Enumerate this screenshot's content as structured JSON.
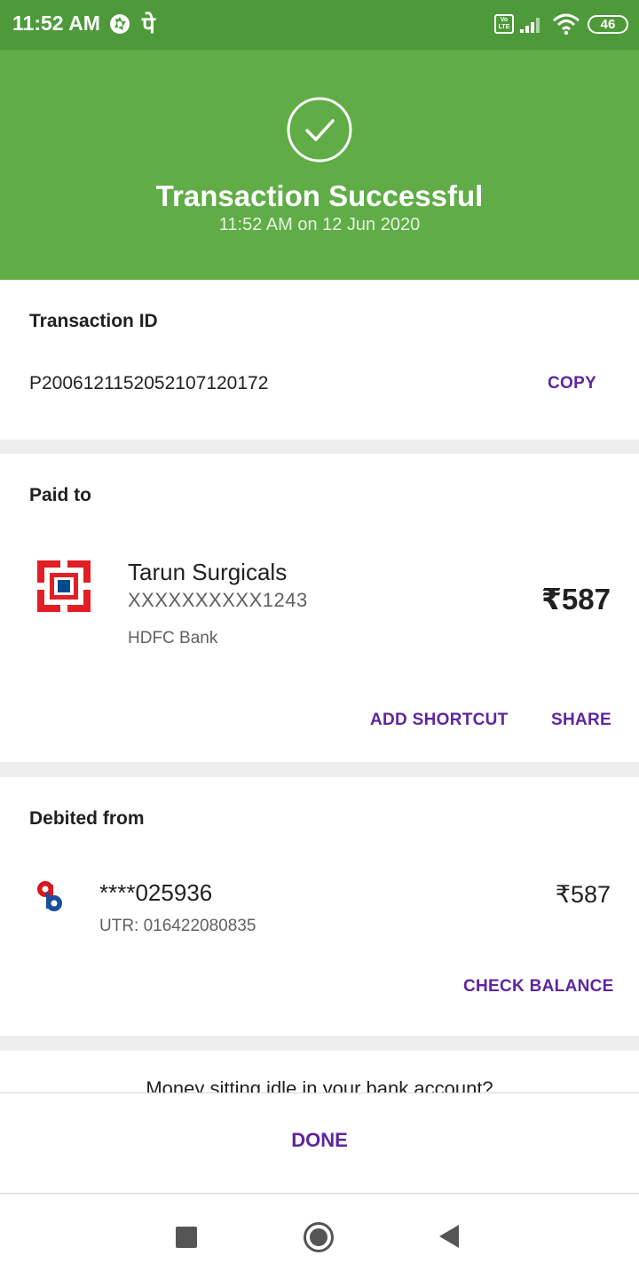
{
  "status_bar": {
    "time": "11:52 AM",
    "app_glyph": "पे",
    "network_badge": "Vo LTE",
    "battery": "46",
    "icons": [
      "aperture-icon",
      "volte-icon",
      "signal-icon",
      "wifi-icon",
      "battery-icon"
    ]
  },
  "header": {
    "title": "Transaction Successful",
    "subtitle": "11:52 AM on 12 Jun 2020",
    "icon": "check-circle-icon",
    "color": "#60ac47"
  },
  "transaction": {
    "label": "Transaction ID",
    "id": "P2006121152052107120172",
    "copy_label": "COPY"
  },
  "paid_to": {
    "label": "Paid to",
    "name": "Tarun Surgicals",
    "account": "XXXXXXXXXX1243",
    "bank": "HDFC Bank",
    "amount": "₹587",
    "logo": "hdfc-bank-logo",
    "actions": {
      "add_shortcut": "ADD SHORTCUT",
      "share": "SHARE"
    }
  },
  "debited_from": {
    "label": "Debited from",
    "account": "****025936",
    "utr": "UTR: 016422080835",
    "amount": "₹587",
    "logo": "union-bank-logo",
    "action": "CHECK BALANCE"
  },
  "promo": {
    "text": "Money sitting idle in your bank account?"
  },
  "footer": {
    "done_label": "DONE"
  },
  "nav": {
    "icons": [
      "recent-apps-icon",
      "home-icon",
      "back-icon"
    ]
  },
  "colors": {
    "accent": "#5f259f",
    "success": "#60ac47",
    "status_bar": "#4e9a3a"
  }
}
